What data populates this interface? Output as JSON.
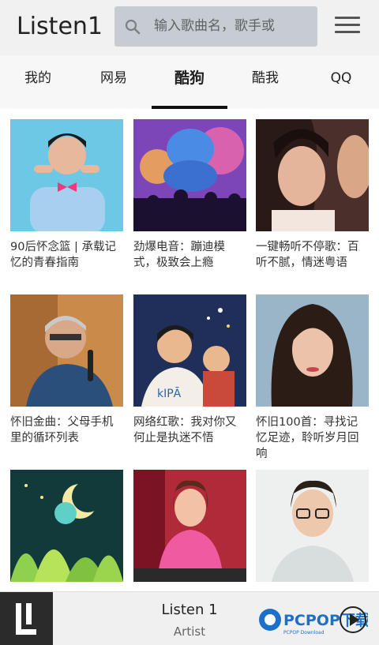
{
  "header": {
    "title": "Listen1",
    "search_placeholder": "输入歌曲名，歌手或"
  },
  "tabs": [
    {
      "label": "我的"
    },
    {
      "label": "网易"
    },
    {
      "label": "酷狗",
      "active": true
    },
    {
      "label": "酷我"
    },
    {
      "label": "QQ"
    }
  ],
  "playlists": [
    {
      "title": "90后怀念篮 | 承载记忆的青春指南",
      "icon": "cover-man-pink-bowtie"
    },
    {
      "title": "劲爆电音：蹦迪模式，极致会上瘾",
      "icon": "cover-genie-dance"
    },
    {
      "title": "一键畅听不停歌：百听不腻，情迷粤语",
      "icon": "cover-film-still"
    },
    {
      "title": "怀旧金曲：父母手机里的循环列表",
      "icon": "cover-singer-microphone"
    },
    {
      "title": "网络红歌：我对你又何止是执迷不悟",
      "icon": "cover-illustrated-friends"
    },
    {
      "title": "怀旧100首：寻找记忆足迹，聆听岁月回响",
      "icon": "cover-woman-portrait"
    },
    {
      "title": "",
      "icon": "cover-moon-illustration"
    },
    {
      "title": "",
      "icon": "cover-dj-girl"
    },
    {
      "title": "",
      "icon": "cover-man-glasses"
    }
  ],
  "player": {
    "title": "Listen 1",
    "artist": "Artist",
    "watermark": "PCPOP下载",
    "watermark_sub": "PCPOP Download"
  },
  "colors": {
    "header_bg": "#f1f1f1",
    "search_bg": "#c7ccd2",
    "active_underline": "#111111"
  }
}
